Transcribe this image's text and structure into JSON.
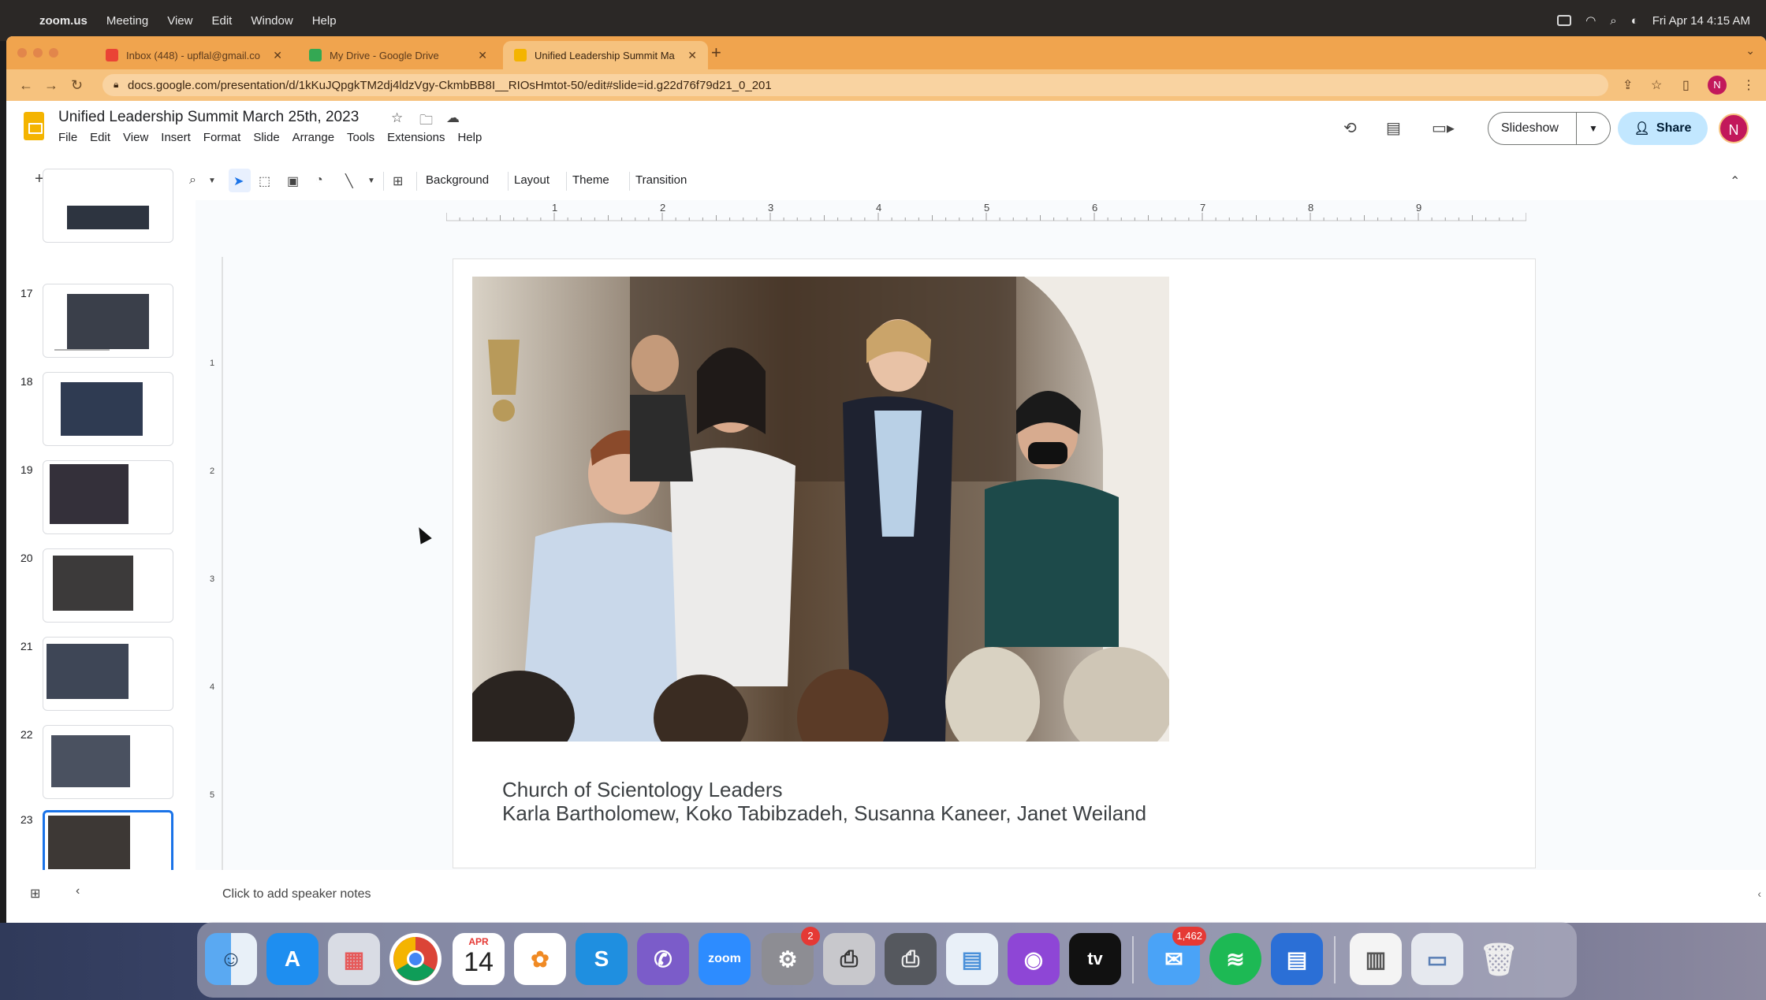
{
  "menubar": {
    "app": "zoom.us",
    "items": [
      "Meeting",
      "View",
      "Edit",
      "Window",
      "Help"
    ],
    "datetime": "Fri Apr 14  4:15 AM"
  },
  "browser": {
    "tabs": [
      {
        "title": "Inbox (448) - upflal@gmail.co"
      },
      {
        "title": "My Drive - Google Drive"
      },
      {
        "title": "Unified Leadership Summit Ma"
      }
    ],
    "url": "docs.google.com/presentation/d/1kKuJQpgkTM2dj4ldzVgy-CkmbBB8I__RIOsHmtot-50/edit#slide=id.g22d76f79d21_0_201",
    "profile_initial": "N"
  },
  "app": {
    "title": "Unified Leadership Summit  March 25th, 2023",
    "menu": [
      "File",
      "Edit",
      "View",
      "Insert",
      "Format",
      "Slide",
      "Arrange",
      "Tools",
      "Extensions",
      "Help"
    ],
    "slideshow_label": "Slideshow",
    "share_label": "Share",
    "avatar_initial": "N"
  },
  "toolbar": {
    "background_label": "Background",
    "layout_label": "Layout",
    "theme_label": "Theme",
    "transition_label": "Transition"
  },
  "filmstrip": {
    "slides": [
      "17",
      "18",
      "19",
      "20",
      "21",
      "22",
      "23"
    ],
    "selected": "23"
  },
  "ruler": {
    "h_labels": [
      "1",
      "2",
      "3",
      "4",
      "5",
      "6",
      "7",
      "8",
      "9"
    ],
    "v_labels": [
      "1",
      "2",
      "3",
      "4",
      "5"
    ]
  },
  "slide": {
    "caption_line1": "Church of Scientology Leaders",
    "caption_line2": "Karla Bartholomew, Koko Tabibzadeh, Susanna Kaneer, Janet Weiland"
  },
  "notes": {
    "placeholder": "Click to add speaker notes"
  },
  "dock": {
    "calendar_month": "APR",
    "calendar_day": "14",
    "settings_badge": "2",
    "mail_badge": "1,462",
    "zoom_label": "zoom"
  }
}
